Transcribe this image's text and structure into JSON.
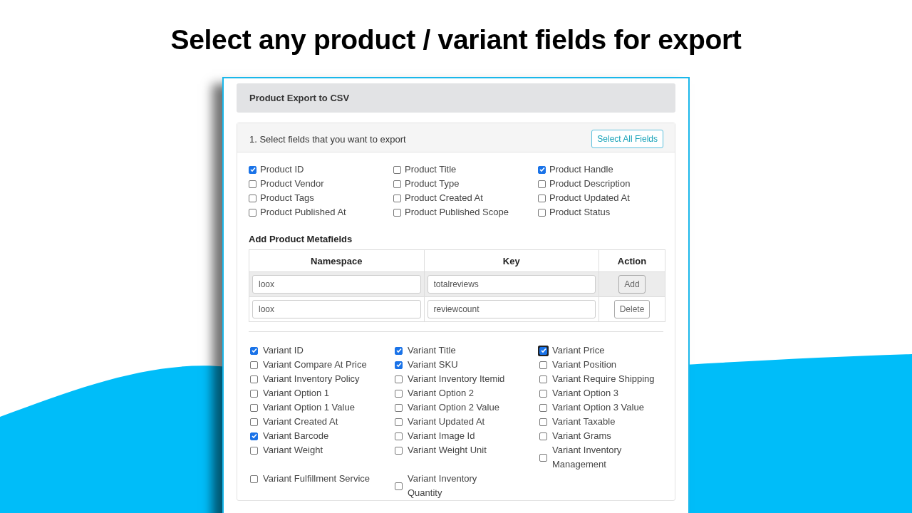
{
  "headline": "Select any product / variant fields for export",
  "panel": {
    "title": "Product Export to CSV",
    "section": {
      "title": "1. Select fields that you want to export",
      "select_all": "Select All Fields",
      "product_fields": [
        {
          "label": "Product ID",
          "checked": true
        },
        {
          "label": "Product Title",
          "checked": false
        },
        {
          "label": "Product Handle",
          "checked": true
        },
        {
          "label": "Product Vendor",
          "checked": false
        },
        {
          "label": "Product Type",
          "checked": false
        },
        {
          "label": "Product Description",
          "checked": false
        },
        {
          "label": "Product Tags",
          "checked": false
        },
        {
          "label": "Product Created At",
          "checked": false
        },
        {
          "label": "Product Updated At",
          "checked": false
        },
        {
          "label": "Product Published At",
          "checked": false
        },
        {
          "label": "Product Published Scope",
          "checked": false
        },
        {
          "label": "Product Status",
          "checked": false
        }
      ],
      "metafields": {
        "title": "Add Product Metafields",
        "columns": [
          "Namespace",
          "Key",
          "Action"
        ],
        "rows": [
          {
            "namespace": "loox",
            "key": "totalreviews",
            "action": "Add",
            "highlighted": true
          },
          {
            "namespace": "loox",
            "key": "reviewcount",
            "action": "Delete",
            "highlighted": false
          }
        ]
      },
      "variant_fields": [
        {
          "label": "Variant ID",
          "checked": true,
          "focused": false
        },
        {
          "label": "Variant Title",
          "checked": true,
          "focused": false
        },
        {
          "label": "Variant Price",
          "checked": true,
          "focused": true
        },
        {
          "label": "Variant Compare At Price",
          "checked": false,
          "focused": false
        },
        {
          "label": "Variant SKU",
          "checked": true,
          "focused": false
        },
        {
          "label": "Variant Position",
          "checked": false,
          "focused": false
        },
        {
          "label": "Variant Inventory Policy",
          "checked": false,
          "focused": false
        },
        {
          "label": "Variant Inventory Itemid",
          "checked": false,
          "focused": false
        },
        {
          "label": "Variant Require Shipping",
          "checked": false,
          "focused": false
        },
        {
          "label": "Variant Option 1",
          "checked": false,
          "focused": false
        },
        {
          "label": "Variant Option 2",
          "checked": false,
          "focused": false
        },
        {
          "label": "Variant Option 3",
          "checked": false,
          "focused": false
        },
        {
          "label": "Variant Option 1 Value",
          "checked": false,
          "focused": false
        },
        {
          "label": "Variant Option 2 Value",
          "checked": false,
          "focused": false
        },
        {
          "label": "Variant Option 3 Value",
          "checked": false,
          "focused": false
        },
        {
          "label": "Variant Created At",
          "checked": false,
          "focused": false
        },
        {
          "label": "Variant Updated At",
          "checked": false,
          "focused": false
        },
        {
          "label": "Variant Taxable",
          "checked": false,
          "focused": false
        },
        {
          "label": "Variant Barcode",
          "checked": true,
          "focused": false
        },
        {
          "label": "Variant Image Id",
          "checked": false,
          "focused": false
        },
        {
          "label": "Variant Grams",
          "checked": false,
          "focused": false
        },
        {
          "label": "Variant Weight",
          "checked": false,
          "focused": false
        },
        {
          "label": "Variant Weight Unit",
          "checked": false,
          "focused": false
        },
        {
          "label": "Variant Inventory\nManagement",
          "checked": false,
          "focused": false
        },
        {
          "label": "Variant Fulfillment Service",
          "checked": false,
          "focused": false
        },
        {
          "label": "Variant Inventory\nQuantity",
          "checked": false,
          "focused": false
        }
      ]
    }
  }
}
